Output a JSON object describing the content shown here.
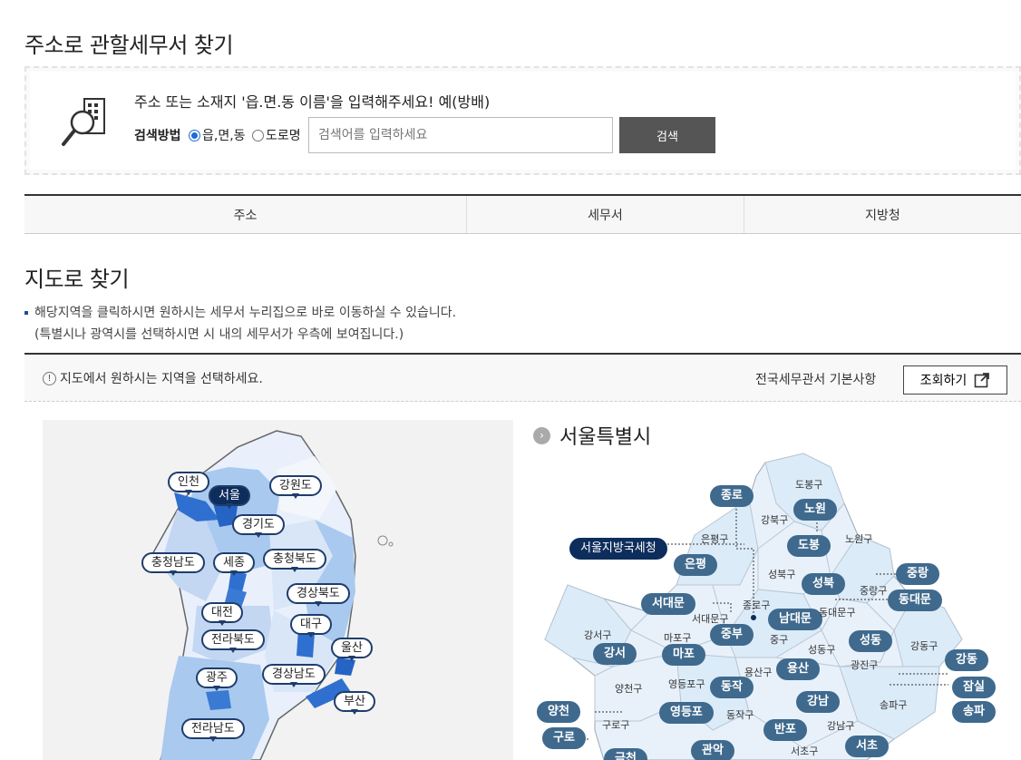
{
  "page": {
    "section1_title": "주소로 관할세무서 찾기",
    "section2_title": "지도로 찾기"
  },
  "search": {
    "guide": "주소 또는 소재지 '읍.면.동 이름'을 입력해주세요! 예(방배)",
    "method_label": "검색방법",
    "radio_dong": "읍,면,동",
    "radio_road": "도로명",
    "selected_method": "읍,면,동",
    "placeholder": "검색어를 입력하세요",
    "button": "검색"
  },
  "result_table": {
    "headers": [
      "주소",
      "세무서",
      "지방청"
    ]
  },
  "notes": {
    "line1": "해당지역을 클릭하시면 원하시는 세무서 누리집으로 바로 이동하실 수 있습니다.",
    "line2": "(특별시나 광역시를 선택하시면 시 내의 세무서가 우측에 보여집니다.)"
  },
  "map_bar": {
    "info": "지도에서 원하시는 지역을 선택하세요.",
    "basic": "전국세무관서 기본사항",
    "query_button": "조회하기"
  },
  "korea_map": {
    "selected": "서울",
    "regions": [
      "인천",
      "서울",
      "강원도",
      "경기도",
      "충청남도",
      "세종",
      "충청북도",
      "경상북도",
      "대전",
      "대구",
      "전라북도",
      "울산",
      "광주",
      "경상남도",
      "부산",
      "전라남도"
    ]
  },
  "seoul": {
    "title": "서울특별시",
    "regional_office": "서울지방국세청",
    "offices": [
      "종로",
      "노원",
      "도봉",
      "은평",
      "중랑",
      "성북",
      "서대문",
      "동대문",
      "남대문",
      "중부",
      "강서",
      "마포",
      "성동",
      "용산",
      "강동",
      "동작",
      "잠실",
      "양천",
      "영등포",
      "강남",
      "송파",
      "구로",
      "반포",
      "서초",
      "금천",
      "관악"
    ],
    "districts": [
      "도봉구",
      "강북구",
      "노원구",
      "은평구",
      "성북구",
      "중랑구",
      "종로구",
      "서대문구",
      "동대문구",
      "강서구",
      "마포구",
      "중구",
      "성동구",
      "강동구",
      "용산구",
      "광진구",
      "양천구",
      "영등포구",
      "동작구",
      "송파구",
      "구로구",
      "강남구",
      "서초구"
    ]
  },
  "colors": {
    "accent_navy": "#0d2d5c",
    "pill_blue": "#3f6a8e",
    "map_light": "#e8f1fa",
    "map_mid": "#a9c9ef",
    "map_strong": "#2f6fcf"
  }
}
